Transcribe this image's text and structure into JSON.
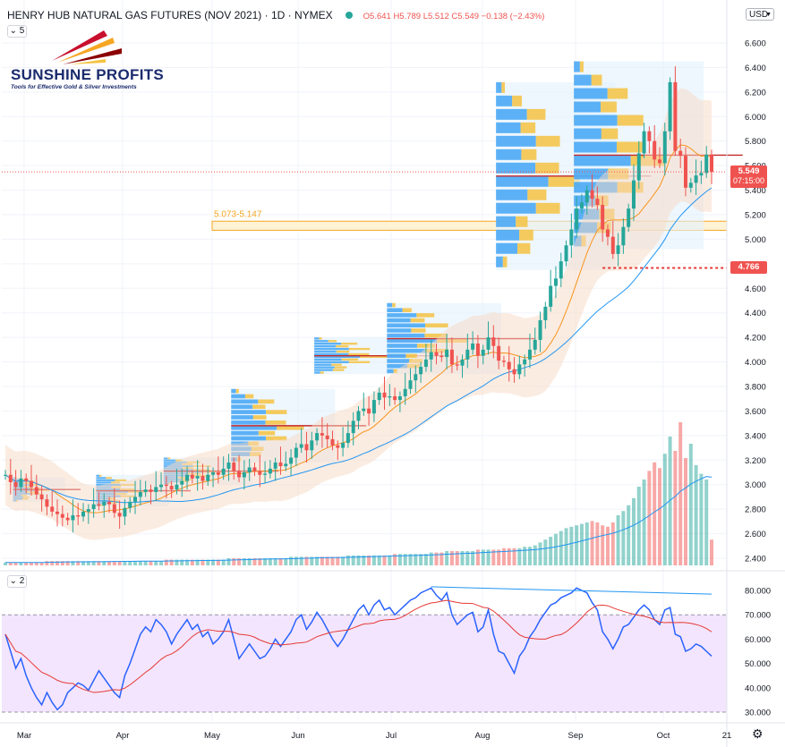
{
  "header": {
    "symbol_title": "HENRY HUB NATURAL GAS FUTURES (NOV 2021) · 1D · NYMEX",
    "ohlc": "O5.641  H5.789  L5.512  C5.549  −0.138 (−2.43%)",
    "currency": "USD",
    "indicator_count_main": "5",
    "indicator_count_rsi": "2"
  },
  "logo": {
    "name": "SUNSHINE PROFITS",
    "tagline": "Tools for Effective Gold & Silver Investments"
  },
  "price_axis": {
    "labels": [
      "6.600",
      "6.400",
      "6.200",
      "6.000",
      "5.800",
      "5.600",
      "5.400",
      "5.200",
      "5.000",
      "4.800",
      "4.600",
      "4.400",
      "4.200",
      "4.000",
      "3.800",
      "3.600",
      "3.400",
      "3.200",
      "3.000",
      "2.800",
      "2.600",
      "2.400"
    ]
  },
  "rsi_axis": {
    "labels": [
      "80.000",
      "70.000",
      "60.000",
      "50.000",
      "40.000",
      "30.000"
    ]
  },
  "time_axis": {
    "labels": [
      "Mar",
      "Apr",
      "May",
      "Jun",
      "Jul",
      "Aug",
      "Sep",
      "Oct",
      "21"
    ]
  },
  "annotations": {
    "zone_label": "5.073-5.147",
    "last_price": "5.549",
    "countdown": "07:15:00",
    "marked_level": "4.766"
  },
  "colors": {
    "up": "#26a69a",
    "down": "#ef5350",
    "ma_fast": "#f7941d",
    "ma_slow": "#2196f3",
    "zone": "#f5a623",
    "rsi": "#2962ff",
    "rsi_bg": "#f3e5fd"
  },
  "chart_data": {
    "type": "candlestick",
    "price_range": [
      2.32,
      6.72
    ],
    "rsi_range": [
      27,
      84
    ],
    "rsi_levels": [
      70,
      30
    ],
    "zone": [
      5.073,
      5.147
    ],
    "last_close": 5.549,
    "support_level": 4.766,
    "closes": [
      3.08,
      3.02,
      2.98,
      3.05,
      3.03,
      2.98,
      2.92,
      2.88,
      2.82,
      2.78,
      2.76,
      2.73,
      2.71,
      2.75,
      2.74,
      2.78,
      2.8,
      2.84,
      2.83,
      2.86,
      2.84,
      2.77,
      2.74,
      2.81,
      2.86,
      2.9,
      2.94,
      2.96,
      2.94,
      2.98,
      3.0,
      2.99,
      2.96,
      3.0,
      3.03,
      3.08,
      3.05,
      3.07,
      3.03,
      3.08,
      3.1,
      3.08,
      3.13,
      3.18,
      3.11,
      3.06,
      3.1,
      3.14,
      3.11,
      3.08,
      3.09,
      3.13,
      3.18,
      3.15,
      3.17,
      3.22,
      3.3,
      3.33,
      3.28,
      3.36,
      3.42,
      3.4,
      3.37,
      3.32,
      3.3,
      3.34,
      3.42,
      3.52,
      3.6,
      3.62,
      3.58,
      3.69,
      3.75,
      3.71,
      3.72,
      3.69,
      3.72,
      3.78,
      3.85,
      3.9,
      3.96,
      4.02,
      4.08,
      4.05,
      4.04,
      4.1,
      3.98,
      3.97,
      4.02,
      4.1,
      4.15,
      4.05,
      4.1,
      4.2,
      4.13,
      4.01,
      4.0,
      3.94,
      3.9,
      3.98,
      4.02,
      4.1,
      4.18,
      4.34,
      4.45,
      4.62,
      4.68,
      4.82,
      4.95,
      5.08,
      5.25,
      5.3,
      5.4,
      5.33,
      5.28,
      5.08,
      5.02,
      4.88,
      4.95,
      5.1,
      5.25,
      5.48,
      5.7,
      5.88,
      5.8,
      5.65,
      5.62,
      5.88,
      6.28,
      5.72,
      5.68,
      5.42,
      5.46,
      5.52,
      5.54,
      5.69,
      5.549
    ],
    "rsi": [
      62,
      55,
      48,
      52,
      45,
      40,
      36,
      33,
      38,
      34,
      31,
      33,
      38,
      40,
      42,
      41,
      39,
      43,
      47,
      44,
      41,
      38,
      36,
      45,
      50,
      56,
      62,
      65,
      63,
      68,
      66,
      63,
      58,
      62,
      65,
      68,
      64,
      66,
      61,
      63,
      58,
      60,
      63,
      68,
      60,
      52,
      55,
      58,
      55,
      52,
      53,
      56,
      60,
      57,
      60,
      63,
      68,
      70,
      64,
      67,
      71,
      68,
      64,
      60,
      57,
      60,
      64,
      68,
      72,
      74,
      70,
      74,
      76,
      72,
      73,
      70,
      72,
      74,
      76,
      77,
      79,
      80,
      81,
      78,
      76,
      79,
      70,
      66,
      68,
      70,
      71,
      63,
      65,
      72,
      62,
      55,
      54,
      50,
      46,
      53,
      56,
      61,
      64,
      68,
      71,
      74,
      75,
      77,
      78,
      79,
      81,
      80,
      79,
      75,
      72,
      63,
      60,
      56,
      60,
      65,
      66,
      69,
      72,
      74,
      72,
      68,
      66,
      72,
      73,
      62,
      61,
      55,
      56,
      58,
      57,
      55,
      53
    ],
    "volume": [
      2,
      2,
      2,
      2,
      2,
      2,
      2,
      2,
      3,
      3,
      3,
      3,
      3,
      3,
      3,
      3,
      3,
      3,
      3,
      3,
      3,
      3,
      3,
      3,
      3,
      3,
      3,
      3,
      3,
      3,
      3,
      4,
      4,
      4,
      4,
      4,
      4,
      4,
      4,
      4,
      4,
      4,
      4,
      5,
      5,
      5,
      5,
      5,
      5,
      5,
      5,
      5,
      5,
      5,
      5,
      6,
      6,
      6,
      6,
      6,
      6,
      6,
      6,
      6,
      6,
      6,
      7,
      7,
      7,
      7,
      7,
      7,
      7,
      7,
      7,
      8,
      8,
      8,
      8,
      8,
      8,
      8,
      9,
      9,
      9,
      10,
      10,
      10,
      10,
      10,
      10,
      11,
      11,
      11,
      11,
      11,
      12,
      12,
      12,
      12,
      13,
      13,
      14,
      16,
      18,
      20,
      22,
      24,
      26,
      27,
      28,
      29,
      30,
      31,
      30,
      28,
      27,
      30,
      35,
      38,
      42,
      47,
      55,
      60,
      66,
      72,
      68,
      78,
      90,
      80,
      100,
      75,
      85,
      70,
      64,
      60,
      18
    ]
  }
}
